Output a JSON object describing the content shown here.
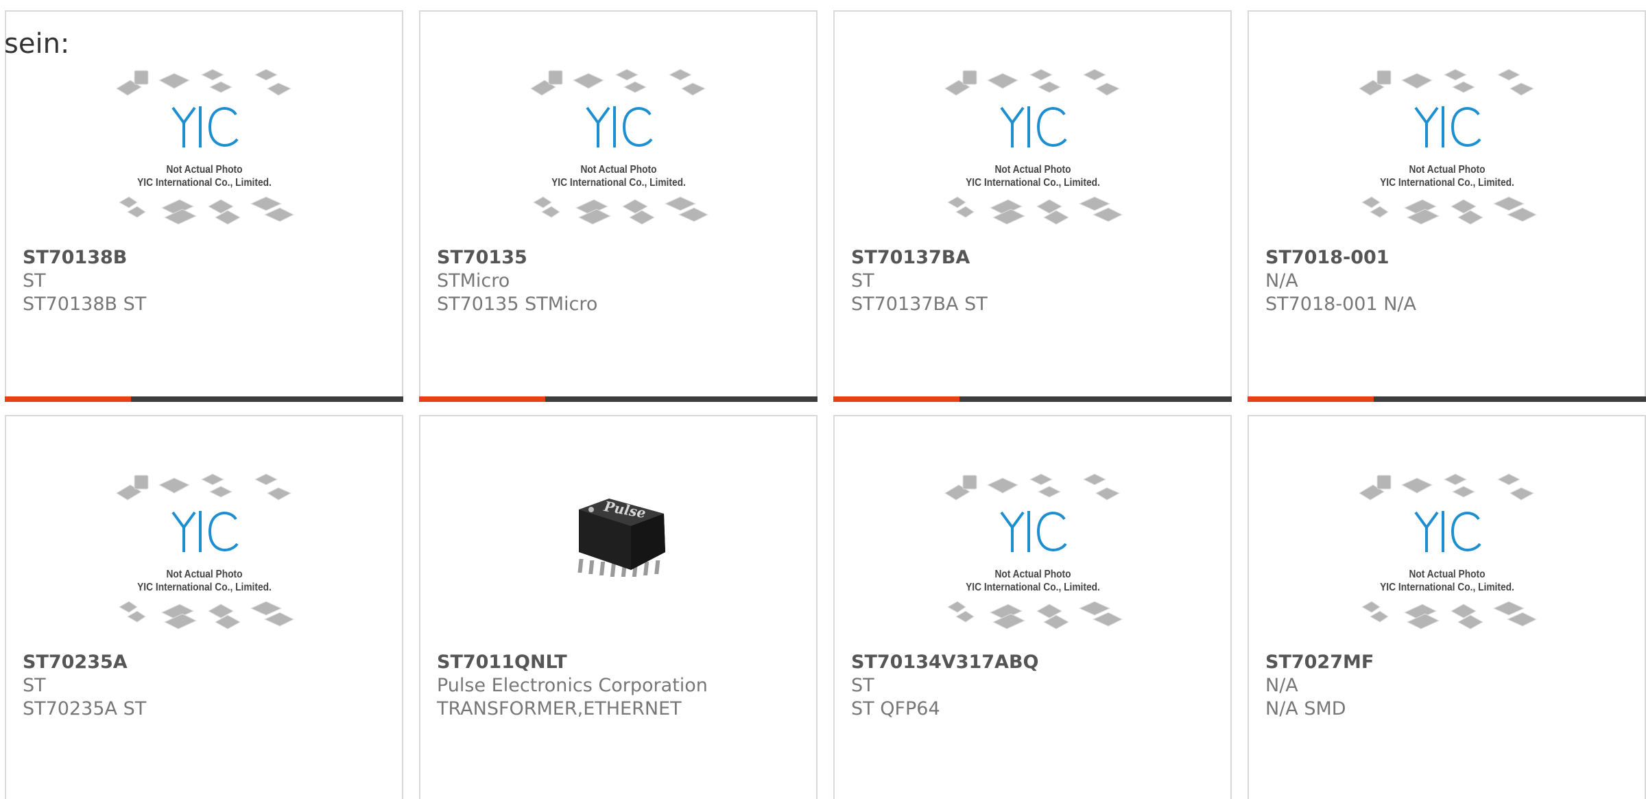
{
  "intro_text": "sein:",
  "placeholder": {
    "line1": "Not Actual Photo",
    "line2": "YIC International Co., Limited.",
    "logo_text": "YIC"
  },
  "colors": {
    "accent": "#ea3e14",
    "bar": "#3d3d3d",
    "logo_blue": "#1d8fd0"
  },
  "products": [
    {
      "pn": "ST70138B",
      "mfr": "ST",
      "desc": "ST70138B ST",
      "image": "placeholder"
    },
    {
      "pn": "ST70135",
      "mfr": "STMicro",
      "desc": "ST70135 STMicro",
      "image": "placeholder"
    },
    {
      "pn": "ST70137BA",
      "mfr": "ST",
      "desc": "ST70137BA ST",
      "image": "placeholder"
    },
    {
      "pn": "ST7018-001",
      "mfr": "N/A",
      "desc": "ST7018-001 N/A",
      "image": "placeholder"
    },
    {
      "pn": "ST70235A",
      "mfr": "ST",
      "desc": "ST70235A ST",
      "image": "placeholder"
    },
    {
      "pn": "ST7011QNLT",
      "mfr": "Pulse Electronics Corporation",
      "desc": "TRANSFORMER,ETHERNET",
      "image": "pulse-chip",
      "brand": "Pulse"
    },
    {
      "pn": "ST70134V317ABQ",
      "mfr": "ST",
      "desc": "ST QFP64",
      "image": "placeholder"
    },
    {
      "pn": "ST7027MF",
      "mfr": "N/A",
      "desc": "N/A SMD",
      "image": "placeholder"
    }
  ]
}
